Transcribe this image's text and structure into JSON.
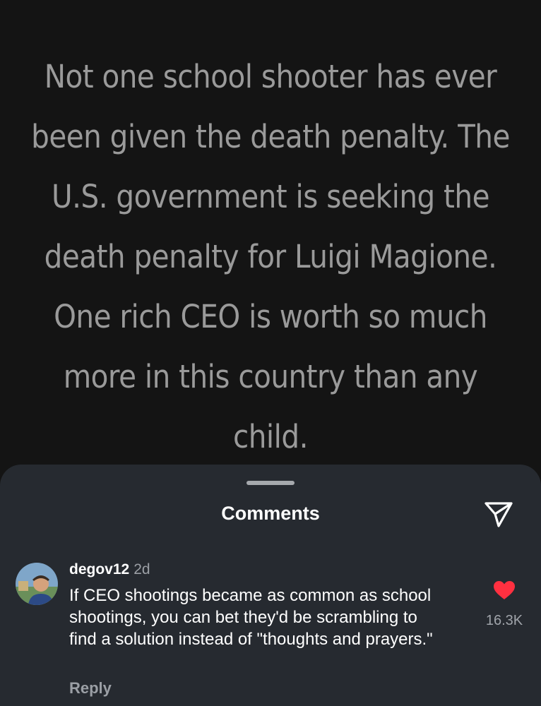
{
  "post": {
    "text": "Not one school shooter has ever been given the death penalty. The U.S. government is seeking the death penalty for Luigi Magione.  One rich CEO is worth so much more in this country than any child."
  },
  "sheet": {
    "title": "Comments",
    "share_icon": "paper-plane-icon"
  },
  "comments": [
    {
      "username": "degov12",
      "age": "2d",
      "text": "If CEO shootings became as common as school shootings, you can bet they'd be scrambling to find a solution instead of \"thoughts and prayers.\"",
      "reply_label": "Reply",
      "likes": "16.3K",
      "liked": true,
      "like_icon": "heart-icon",
      "like_color": "#ff3040"
    }
  ],
  "colors": {
    "post_background": "#141414",
    "post_text": "#9a9a9a",
    "sheet_background": "#262a30",
    "secondary_text": "#9b9fa5"
  }
}
